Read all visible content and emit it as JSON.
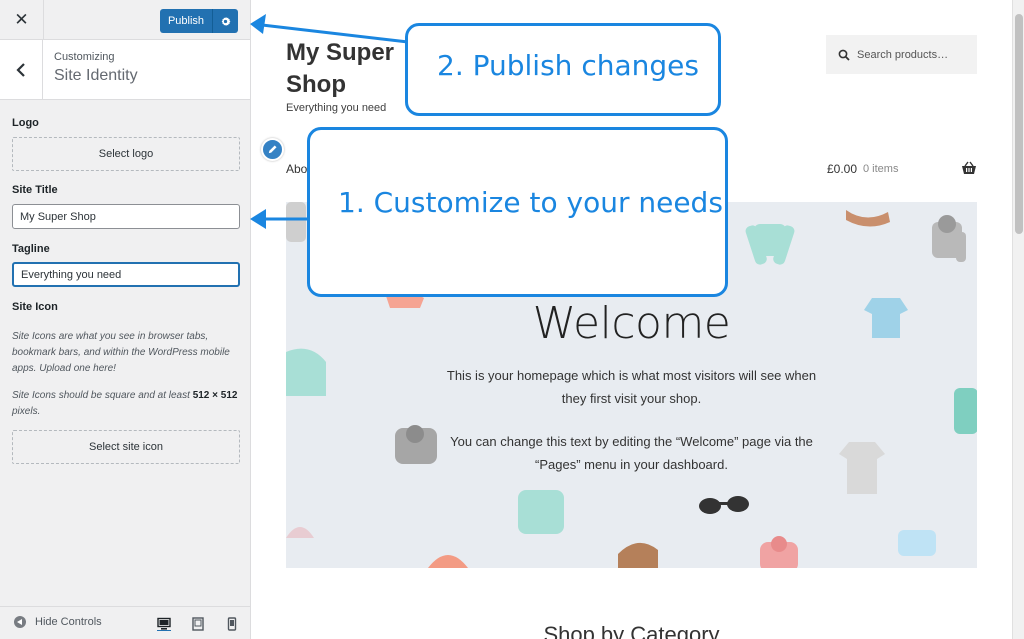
{
  "customizer": {
    "header": {
      "close_icon": "close-icon",
      "publish_label": "Publish",
      "settings_icon": "gear-icon"
    },
    "section": {
      "breadcrumb": "Customizing",
      "title": "Site Identity"
    },
    "logo": {
      "label": "Logo",
      "button": "Select logo"
    },
    "site_title": {
      "label": "Site Title",
      "value": "My Super Shop"
    },
    "tagline": {
      "label": "Tagline",
      "value": "Everything you need"
    },
    "site_icon": {
      "label": "Site Icon",
      "desc1": "Site Icons are what you see in browser tabs, bookmark bars, and within the WordPress mobile apps. Upload one here!",
      "desc2_prefix": "Site Icons should be square and at least ",
      "desc2_bold": "512 × 512",
      "desc2_suffix": " pixels.",
      "button": "Select site icon"
    },
    "footer": {
      "hide_controls": "Hide Controls",
      "devices": [
        "desktop-icon",
        "tablet-icon",
        "mobile-icon"
      ]
    }
  },
  "preview": {
    "site_title": "My Super Shop",
    "tagline": "Everything you need",
    "search_placeholder": "Search products…",
    "nav_first": "Abo",
    "cart_price": "£0.00",
    "cart_items": "0 items",
    "hero": {
      "title": "Welcome",
      "text1": "This is your homepage which is what most visitors will see when they first visit your shop.",
      "text2": "You can change this text by editing the “Welcome” page via the “Pages” menu in your dashboard."
    },
    "section_heading": "Shop by Category"
  },
  "callouts": {
    "publish": "2. Publish changes",
    "customize": "1. Customize to your needs"
  },
  "colors": {
    "accent": "#2271b1",
    "callout": "#1a86e0",
    "sidebar_bg": "#f0f0f1",
    "hero_bg": "#e8ecf1"
  }
}
